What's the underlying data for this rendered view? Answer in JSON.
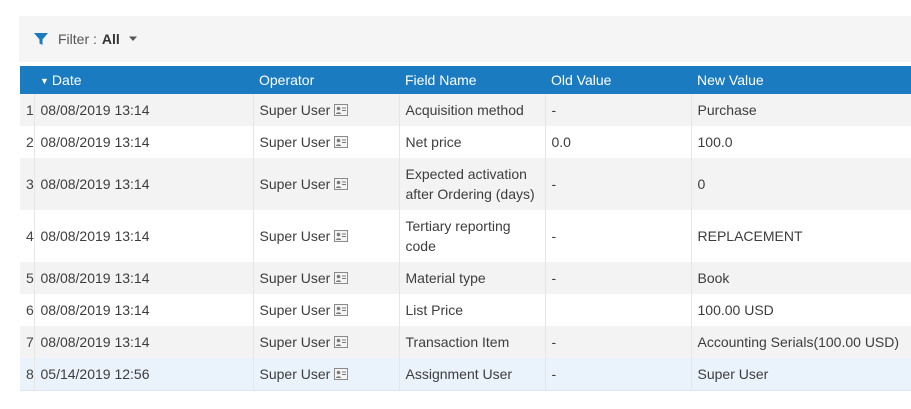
{
  "filter": {
    "label": "Filter :",
    "value": "All"
  },
  "columns": {
    "index": "",
    "date": "Date",
    "operator": "Operator",
    "field_name": "Field Name",
    "old_value": "Old Value",
    "new_value": "New Value"
  },
  "rows": [
    {
      "index": "1",
      "date": "08/08/2019 13:14",
      "operator": "Super User",
      "field_name": "Acquisition method",
      "old_value": "-",
      "new_value": "Purchase"
    },
    {
      "index": "2",
      "date": "08/08/2019 13:14",
      "operator": "Super User",
      "field_name": "Net price",
      "old_value": "0.0",
      "new_value": "100.0"
    },
    {
      "index": "3",
      "date": "08/08/2019 13:14",
      "operator": "Super User",
      "field_name": "Expected activation after Ordering (days)",
      "old_value": "-",
      "new_value": "0"
    },
    {
      "index": "4",
      "date": "08/08/2019 13:14",
      "operator": "Super User",
      "field_name": "Tertiary reporting code",
      "old_value": "-",
      "new_value": "REPLACEMENT"
    },
    {
      "index": "5",
      "date": "08/08/2019 13:14",
      "operator": "Super User",
      "field_name": "Material type",
      "old_value": "-",
      "new_value": "Book"
    },
    {
      "index": "6",
      "date": "08/08/2019 13:14",
      "operator": "Super User",
      "field_name": "List Price",
      "old_value": "",
      "new_value": "100.00 USD"
    },
    {
      "index": "7",
      "date": "08/08/2019 13:14",
      "operator": "Super User",
      "field_name": "Transaction Item",
      "old_value": "-",
      "new_value": "Accounting Serials(100.00 USD)"
    },
    {
      "index": "8",
      "date": "05/14/2019 12:56",
      "operator": "Super User",
      "field_name": "Assignment User",
      "old_value": "-",
      "new_value": "Super User"
    }
  ],
  "icons": {
    "filter": "filter-funnel-icon",
    "dropdown": "caret-down-icon",
    "sort": "sort-descending-icon",
    "user_card": "user-card-icon"
  },
  "colors": {
    "header_bg": "#1a7bc1",
    "accent": "#1a7bc1",
    "row_alt": "#f3f3f3",
    "row_highlight": "#eaf2fb"
  }
}
